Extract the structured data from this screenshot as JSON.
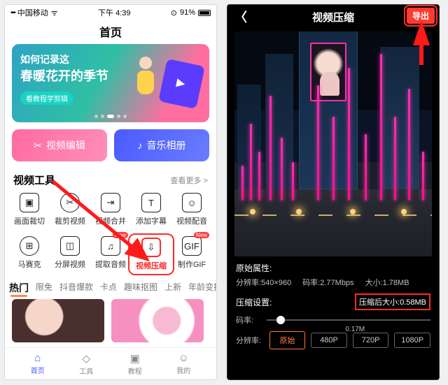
{
  "left": {
    "status": {
      "carrier": "中国移动",
      "time": "下午 4:39",
      "battery": "91%"
    },
    "nav_title": "首页",
    "banner": {
      "line1": "如何记录这",
      "line2": "春暖花开的季节",
      "tag": "看教程学剪辑"
    },
    "pills": {
      "edit": "视频编辑",
      "album": "音乐相册"
    },
    "section": {
      "title": "视频工具",
      "more": "查看更多 >"
    },
    "tools": [
      {
        "label": "画面裁切",
        "glyph": "▣"
      },
      {
        "label": "裁剪视频",
        "glyph": "✂"
      },
      {
        "label": "视频合并",
        "glyph": "⇥"
      },
      {
        "label": "添加字幕",
        "glyph": "T"
      },
      {
        "label": "视频配音",
        "glyph": "☺"
      },
      {
        "label": "马赛克",
        "glyph": "⊞"
      },
      {
        "label": "分屏视频",
        "glyph": "◫"
      },
      {
        "label": "提取音频",
        "glyph": "♫",
        "badge": "New"
      },
      {
        "label": "视频压缩",
        "glyph": "⇩",
        "highlight": true
      },
      {
        "label": "制作GIF",
        "glyph": "GIF",
        "badge": "New"
      }
    ],
    "tabs": [
      "热门",
      "限免",
      "抖音爆款",
      "卡点",
      "趣味抠图",
      "上新",
      "年龄变换"
    ],
    "tabbar": [
      {
        "label": "首页",
        "icon": "⌂"
      },
      {
        "label": "工具",
        "icon": "◇"
      },
      {
        "label": "教程",
        "icon": "▣"
      },
      {
        "label": "我的",
        "icon": "☺"
      }
    ]
  },
  "right": {
    "nav": {
      "title": "视频压缩",
      "export": "导出"
    },
    "orig": {
      "header": "原始属性:",
      "res_label": "分辨率:540×960",
      "bitrate_label": "码率:2.77Mbps",
      "size_label": "大小:1.78MB"
    },
    "set": {
      "header": "压缩设置:",
      "after": "压缩后大小:0.58MB",
      "bitrate_lab": "码率:",
      "bitrate_val": "0.17M",
      "res_lab": "分辨率:",
      "res_opts": [
        "原始",
        "480P",
        "720P",
        "1080P"
      ]
    }
  }
}
